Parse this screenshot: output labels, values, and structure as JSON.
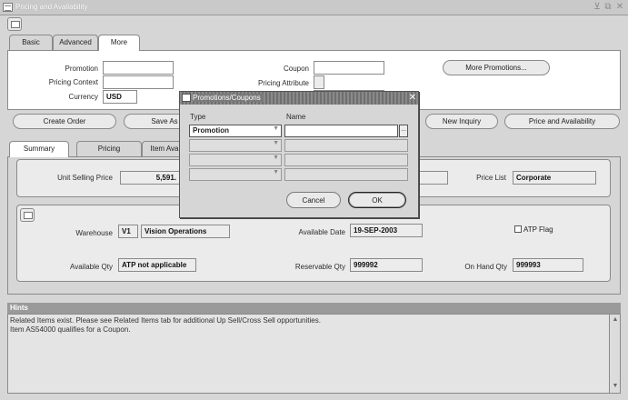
{
  "window": {
    "title": "Pricing and Availability",
    "controls": {
      "minimize": "⊻",
      "restore": "⧉",
      "close": "✕"
    }
  },
  "tabs_top": [
    {
      "label": "Basic"
    },
    {
      "label": "Advanced"
    },
    {
      "label": "More"
    }
  ],
  "more_tab": {
    "promotion_label": "Promotion",
    "promotion_value": "",
    "pricing_context_label": "Pricing Context",
    "pricing_context_value": "",
    "currency_label": "Currency",
    "currency_value": "USD",
    "coupon_label": "Coupon",
    "coupon_value": "",
    "pricing_attribute_label": "Pricing Attribute",
    "more_promotions_button": "More Promotions..."
  },
  "action_buttons": {
    "create_order": "Create Order",
    "save": "Save As",
    "new_inquiry": "New Inquiry",
    "price_and_availability": "Price and Availability"
  },
  "tabs_bottom": [
    {
      "label": "Summary"
    },
    {
      "label": "Pricing"
    },
    {
      "label": "Item Ava"
    }
  ],
  "summary": {
    "unit_selling_price_label": "Unit Selling Price",
    "unit_selling_price_value": "5,591.",
    "price_list_label": "Price List",
    "price_list_value": "Corporate",
    "warehouse_label": "Warehouse",
    "warehouse_code": "V1",
    "warehouse_name": "Vision Operations",
    "available_date_label": "Available Date",
    "available_date_value": "19-SEP-2003",
    "atp_flag_label": "ATP Flag",
    "available_qty_label": "Available Qty",
    "available_qty_value": "ATP not applicable",
    "reservable_qty_label": "Reservable Qty",
    "reservable_qty_value": "999992",
    "on_hand_qty_label": "On Hand Qty",
    "on_hand_qty_value": "999993"
  },
  "hints": {
    "title": "Hints",
    "lines": [
      "Related Items exist. Please see Related Items tab for additional Up Sell/Cross Sell opportunities.",
      "Item AS54000 qualifies for a Coupon."
    ]
  },
  "dialog": {
    "title": "Promotions/Coupons",
    "col_type": "Type",
    "col_name": "Name",
    "rows": [
      {
        "type": "Promotion",
        "name": ""
      },
      {
        "type": "",
        "name": ""
      },
      {
        "type": "",
        "name": ""
      },
      {
        "type": "",
        "name": ""
      }
    ],
    "cancel_button": "Cancel",
    "ok_button": "OK",
    "lov_glyph": "..."
  }
}
